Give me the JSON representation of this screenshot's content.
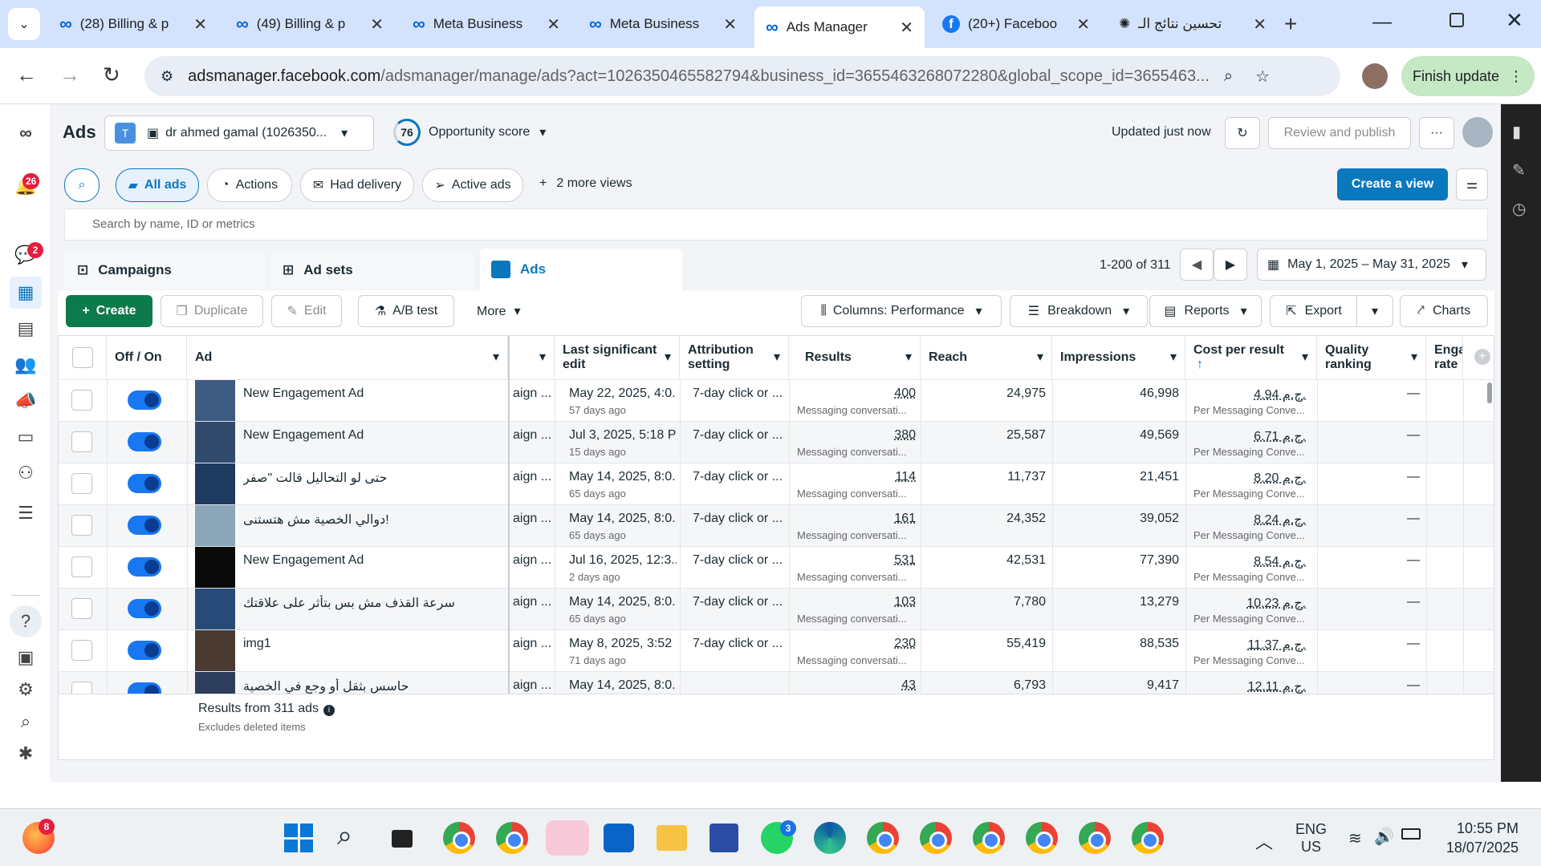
{
  "browser": {
    "tabs": [
      {
        "title": "(28) Billing & p",
        "active": false
      },
      {
        "title": "(49) Billing & p",
        "active": false
      },
      {
        "title": "Meta Business",
        "active": false
      },
      {
        "title": "Meta Business",
        "active": false
      },
      {
        "title": "Ads Manager",
        "active": true
      },
      {
        "title": "(20+) Faceboo",
        "active": false
      },
      {
        "title": "تحسين نتائج الـ",
        "active": false
      }
    ],
    "url_host": "adsmanager.facebook.com",
    "url_rest": "/adsmanager/manage/ads?act=1026350465582794&business_id=3655463268072280&global_scope_id=3655463...",
    "finish_update": "Finish update"
  },
  "rail": {
    "notifications_badge": "26",
    "chat_badge": "2"
  },
  "header": {
    "title": "Ads",
    "account_initial": "T",
    "account_name": "dr ahmed gamal (1026350...",
    "score": "76",
    "opportunity": "Opportunity score",
    "updated": "Updated just now",
    "review_publish": "Review and publish",
    "more": "···"
  },
  "views": {
    "all_ads": "All ads",
    "actions": "Actions",
    "had_delivery": "Had delivery",
    "active_ads": "Active ads",
    "more_views": "2 more views",
    "create_view": "Create a view",
    "search_placeholder": "Search by name, ID or metrics"
  },
  "level_tabs": {
    "campaigns": "Campaigns",
    "adsets": "Ad sets",
    "ads": "Ads",
    "pagination": "1-200 of 311",
    "date_range": "May 1, 2025 – May 31, 2025"
  },
  "toolbar": {
    "create": "Create",
    "duplicate": "Duplicate",
    "edit": "Edit",
    "ab_test": "A/B test",
    "more": "More",
    "columns": "Columns: Performance",
    "breakdown": "Breakdown",
    "reports": "Reports",
    "export": "Export",
    "charts": "Charts"
  },
  "table": {
    "headers": {
      "off_on": "Off / On",
      "ad": "Ad",
      "last_edit": "Last significant edit",
      "attribution": "Attribution setting",
      "results": "Results",
      "reach": "Reach",
      "impressions": "Impressions",
      "cost_per_result": "Cost per result",
      "quality": "Quality ranking",
      "engagement": "Enga rate"
    },
    "rows": [
      {
        "name": "New Engagement Ad",
        "campaign": "aign ...",
        "edit": "May 22, 2025, 4:0...",
        "edit_ago": "57 days ago",
        "attribution": "7-day click or ...",
        "results": "400",
        "results_sub": "Messaging conversati...",
        "reach": "24,975",
        "impressions": "46,998",
        "cost": "4.94 ج.م.",
        "cost_sub": "Per Messaging Conve...",
        "quality": "—",
        "thumb": "#3d5a80"
      },
      {
        "name": "New Engagement Ad",
        "campaign": "aign ...",
        "edit": "Jul 3, 2025, 5:18 PM",
        "edit_ago": "15 days ago",
        "attribution": "7-day click or ...",
        "results": "380",
        "results_sub": "Messaging conversati...",
        "reach": "25,587",
        "impressions": "49,569",
        "cost": "6.71 ج.م.",
        "cost_sub": "Per Messaging Conve...",
        "quality": "—",
        "thumb": "#2f4a6d"
      },
      {
        "name": "حتى لو التحاليل قالت \"صفر",
        "campaign": "aign ...",
        "edit": "May 14, 2025, 8:0...",
        "edit_ago": "65 days ago",
        "attribution": "7-day click or ...",
        "results": "114",
        "results_sub": "Messaging conversati...",
        "reach": "11,737",
        "impressions": "21,451",
        "cost": "8.20 ج.م.",
        "cost_sub": "Per Messaging Conve...",
        "quality": "—",
        "thumb": "#1e3a5f"
      },
      {
        "name": "دوالي الخصية مش هتستنى!",
        "campaign": "aign ...",
        "edit": "May 14, 2025, 8:0...",
        "edit_ago": "65 days ago",
        "attribution": "7-day click or ...",
        "results": "161",
        "results_sub": "Messaging conversati...",
        "reach": "24,352",
        "impressions": "39,052",
        "cost": "8.24 ج.م.",
        "cost_sub": "Per Messaging Conve...",
        "quality": "—",
        "thumb": "#8aa6b8"
      },
      {
        "name": "New Engagement Ad",
        "campaign": "aign ...",
        "edit": "Jul 16, 2025, 12:3...",
        "edit_ago": "2 days ago",
        "attribution": "7-day click or ...",
        "results": "531",
        "results_sub": "Messaging conversati...",
        "reach": "42,531",
        "impressions": "77,390",
        "cost": "8.54 ج.م.",
        "cost_sub": "Per Messaging Conve...",
        "quality": "—",
        "thumb": "#0a0a0a"
      },
      {
        "name": "سرعة القذف مش بس بتأثر على علاقتك",
        "campaign": "aign ...",
        "edit": "May 14, 2025, 8:0...",
        "edit_ago": "65 days ago",
        "attribution": "7-day click or ...",
        "results": "103",
        "results_sub": "Messaging conversati...",
        "reach": "7,780",
        "impressions": "13,279",
        "cost": "10.23 ج.م.",
        "cost_sub": "Per Messaging Conve...",
        "quality": "—",
        "thumb": "#274b78"
      },
      {
        "name": "img1",
        "campaign": "aign ...",
        "edit": "May 8, 2025, 3:52 ...",
        "edit_ago": "71 days ago",
        "attribution": "7-day click or ...",
        "results": "230",
        "results_sub": "Messaging conversati...",
        "reach": "55,419",
        "impressions": "88,535",
        "cost": "11.37 ج.م.",
        "cost_sub": "Per Messaging Conve...",
        "quality": "—",
        "thumb": "#4a3a32"
      },
      {
        "name": "حاسس بثقل أو وجع في الخصية",
        "campaign": "aign ...",
        "edit": "May 14, 2025, 8:0...",
        "edit_ago": "",
        "attribution": "",
        "results": "43",
        "results_sub": "",
        "reach": "6,793",
        "impressions": "9,417",
        "cost": "12.11 ج.م.",
        "cost_sub": "",
        "quality": "—",
        "thumb": "#2c3e5c"
      }
    ],
    "footer_results": "Results from 311 ads",
    "footer_sub": "Excludes deleted items"
  },
  "taskbar": {
    "lang": "ENG",
    "region": "US",
    "time": "10:55 PM",
    "date": "18/07/2025",
    "badge_firefox": "8",
    "badge_whatsapp": "3"
  }
}
